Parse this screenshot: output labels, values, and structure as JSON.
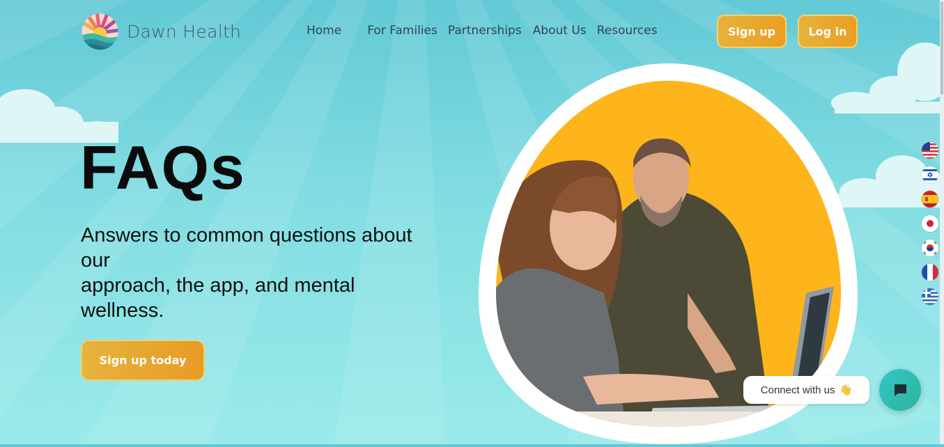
{
  "brand": {
    "name": "Dawn Health"
  },
  "nav": {
    "items": [
      {
        "label": "Home"
      },
      {
        "label": "For Families"
      },
      {
        "label": "Partnerships"
      },
      {
        "label": "About Us"
      },
      {
        "label": "Resources"
      }
    ]
  },
  "header": {
    "signup_label": "Sign up",
    "login_label": "Log in"
  },
  "hero": {
    "title": "FAQs",
    "subtitle_line1": "Answers to common questions about our",
    "subtitle_line2": "approach, the app, and mental wellness.",
    "cta_label": "Sign up today"
  },
  "languages": [
    {
      "icon": "flag-us-icon"
    },
    {
      "icon": "flag-israel-icon"
    },
    {
      "icon": "flag-spain-icon"
    },
    {
      "icon": "flag-japan-icon"
    },
    {
      "icon": "flag-korea-icon"
    },
    {
      "icon": "flag-france-icon"
    },
    {
      "icon": "flag-greece-icon"
    }
  ],
  "chat": {
    "label": "Connect with us",
    "emoji": "👋",
    "icon": "chat-icon"
  },
  "colors": {
    "accent": "#e9a62c",
    "sky": "#7fdbe1",
    "text": "#111111",
    "nav_text": "#2d4656",
    "photo_bg": "#fdb51b"
  }
}
